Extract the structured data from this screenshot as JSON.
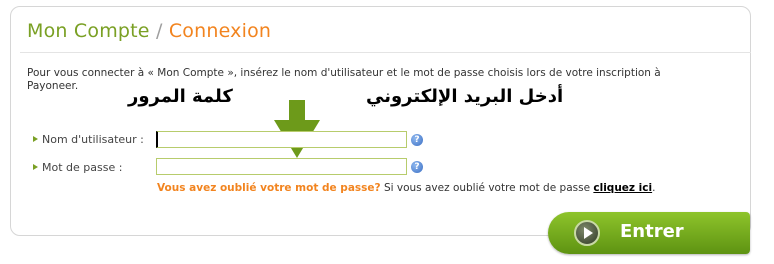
{
  "header": {
    "title_part1": "Mon Compte",
    "separator": "/",
    "title_part2": "Connexion"
  },
  "intro": "Pour vous connecter à « Mon Compte », insérez le nom d'utilisateur et le mot de passe choisis lors de votre inscription à Payoneer.",
  "annotations": {
    "password_ar": "كلمة المرور",
    "email_ar": "أدخل البريد الإلكتروني"
  },
  "form": {
    "username_label": "Nom d'utilisateur :",
    "username_value": "",
    "password_label": "Mot de passe :",
    "password_value": "",
    "help_glyph": "?"
  },
  "forgot": {
    "question": "Vous avez oublié votre mot de passe?",
    "text": " Si vous avez oublié votre mot de passe ",
    "link": "cliquez ici",
    "end": "."
  },
  "submit": {
    "label": "Entrer"
  },
  "colors": {
    "accent_green": "#7aa024",
    "accent_orange": "#f2841f",
    "button_green": "#6fa81c",
    "field_border": "#b7cc6c"
  },
  "icons": [
    "arrow-down-icon",
    "help-icon",
    "play-icon",
    "bullet-triangle-icon"
  ]
}
